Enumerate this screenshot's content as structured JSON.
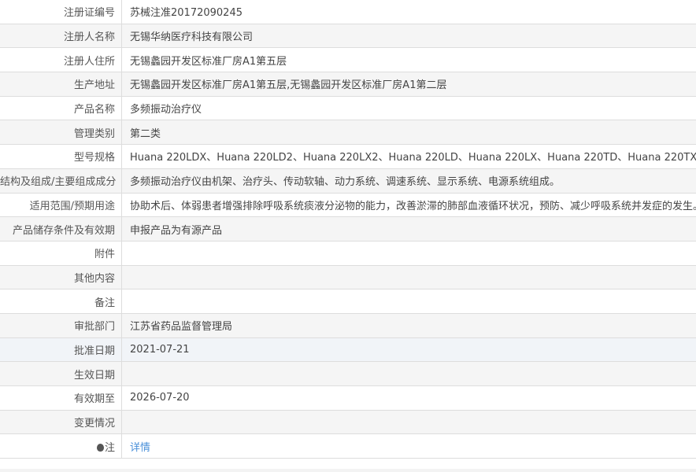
{
  "rows": [
    {
      "label": "注册证编号",
      "value": "苏械注准20172090245"
    },
    {
      "label": "注册人名称",
      "value": "无锡华纳医疗科技有限公司"
    },
    {
      "label": "注册人住所",
      "value": "无锡蠡园开发区标准厂房A1第五层"
    },
    {
      "label": "生产地址",
      "value": "无锡蠡园开发区标准厂房A1第五层,无锡蠡园开发区标准厂房A1第二层"
    },
    {
      "label": "产品名称",
      "value": "多频振动治疗仪"
    },
    {
      "label": "管理类别",
      "value": "第二类"
    },
    {
      "label": "型号规格",
      "value": "Huana 220LDX、Huana 220LD2、Huana 220LX2、Huana 220LD、Huana 220LX、Huana 220TD、Huana 220TX"
    },
    {
      "label": "结构及组成/主要组成成分",
      "value": "多频振动治疗仪由机架、治疗头、传动软轴、动力系统、调速系统、显示系统、电源系统组成。"
    },
    {
      "label": "适用范围/预期用途",
      "value": "协助术后、体弱患者增强排除呼吸系统痰液分泌物的能力，改善淤滞的肺部血液循环状况，预防、减少呼吸系统并发症的发生。"
    },
    {
      "label": "产品储存条件及有效期",
      "value": "申报产品为有源产品"
    },
    {
      "label": "附件",
      "value": ""
    },
    {
      "label": "其他内容",
      "value": ""
    },
    {
      "label": "备注",
      "value": ""
    },
    {
      "label": "审批部门",
      "value": "江苏省药品监督管理局"
    },
    {
      "label": "批准日期",
      "value": "2021-07-21"
    },
    {
      "label": "生效日期",
      "value": ""
    },
    {
      "label": "有效期至",
      "value": "2026-07-20"
    },
    {
      "label": "变更情况",
      "value": ""
    }
  ],
  "note": {
    "label": "注",
    "link": "详情",
    "icon": "lightbulb-icon"
  }
}
